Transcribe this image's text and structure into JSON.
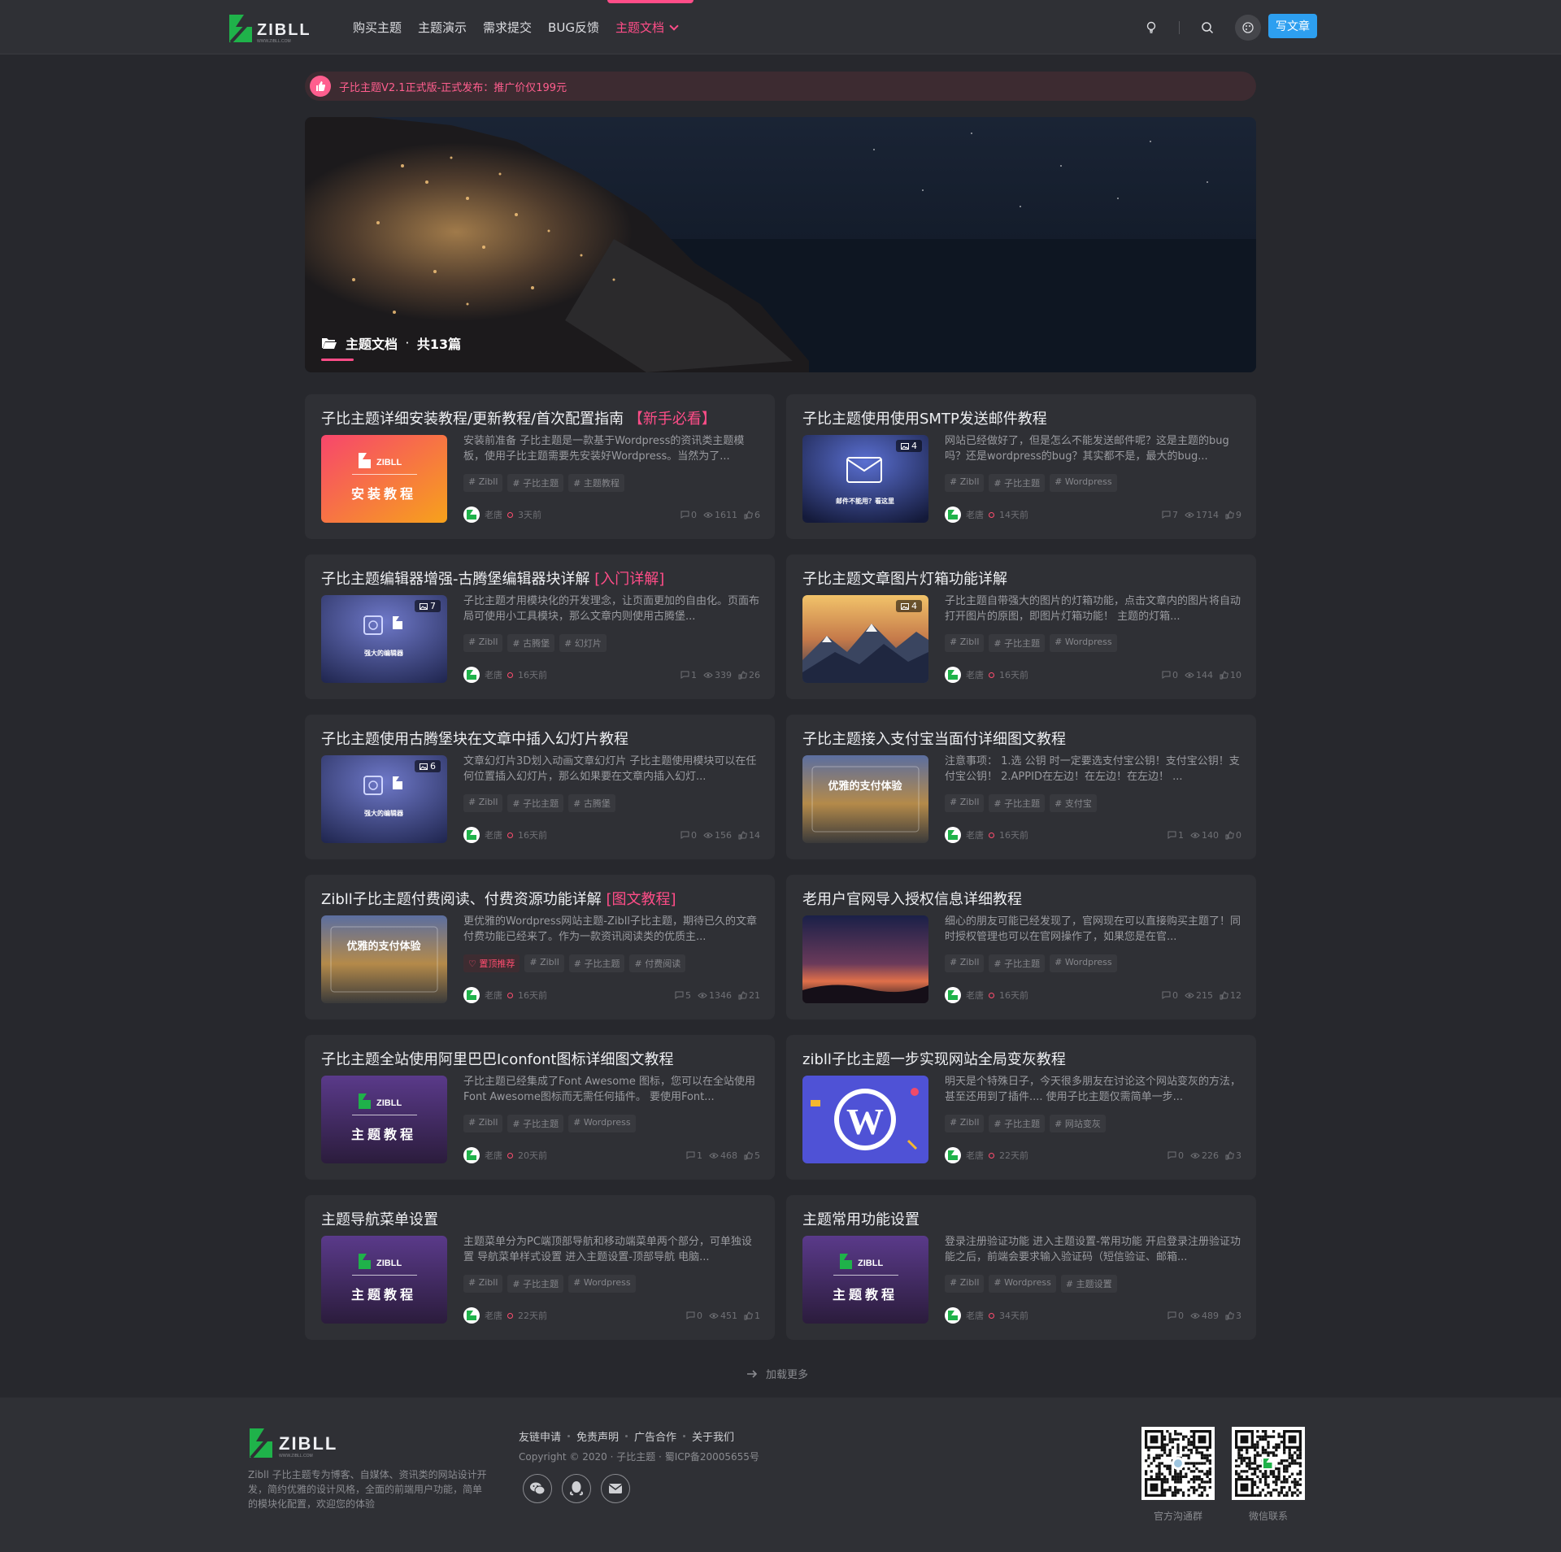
{
  "header": {
    "logo_text": "ZIBLL",
    "logo_sub": "WWW.ZIBLL.COM",
    "nav": [
      {
        "label": "购买主题"
      },
      {
        "label": "主题演示"
      },
      {
        "label": "需求提交"
      },
      {
        "label": "BUG反馈"
      },
      {
        "label": "主题文档"
      }
    ],
    "write_label": "写文章"
  },
  "notice": {
    "text": "子比主题V2.1正式版-正式发布：推广价仅199元"
  },
  "banner": {
    "category": "主题文档",
    "count": "共13篇"
  },
  "cards": [
    {
      "title": "子比主题详细安装教程/更新教程/首次配置指南",
      "title_tag": "【新手必看】",
      "thumb": "install",
      "thumb_text": "安装教程",
      "img_count": "",
      "excerpt": "安装前准备 子比主题是一款基于Wordpress的资讯类主题模板，使用子比主题需要先安装好Wordpress。当然为了...",
      "top_tag": "",
      "tags": [
        "# Zibll",
        "# 子比主题",
        "# 主题教程"
      ],
      "author": "老唐",
      "time": "3天前",
      "comments": "0",
      "views": "1611",
      "likes": "6"
    },
    {
      "title": "子比主题使用使用SMTP发送邮件教程",
      "title_tag": "",
      "thumb": "smtp",
      "thumb_text": "邮件不能用？看这里",
      "img_count": "4",
      "excerpt": "网站已经做好了，但是怎么不能发送邮件呢？这是主题的bug吗？还是wordpress的bug？其实都不是，最大的bug...",
      "top_tag": "",
      "tags": [
        "# Zibll",
        "# 子比主题",
        "# Wordpress"
      ],
      "author": "老唐",
      "time": "14天前",
      "comments": "7",
      "views": "1714",
      "likes": "9"
    },
    {
      "title": "子比主题编辑器增强-古腾堡编辑器块详解",
      "title_tag": "[入门详解]",
      "thumb": "gutenberg",
      "thumb_text": "强大的编辑器",
      "img_count": "7",
      "excerpt": "子比主题才用模块化的开发理念，让页面更加的自由化。页面布局可使用小工具模块，那么文章内则使用古腾堡...",
      "top_tag": "",
      "tags": [
        "# Zibll",
        "# 古腾堡",
        "# 幻灯片"
      ],
      "author": "老唐",
      "time": "16天前",
      "comments": "1",
      "views": "339",
      "likes": "26"
    },
    {
      "title": "子比主题文章图片灯箱功能详解",
      "title_tag": "",
      "thumb": "mountain",
      "thumb_text": "",
      "img_count": "4",
      "excerpt": "子比主题自带强大的图片的灯箱功能，点击文章内的图片将自动打开图片的原图，即图片灯箱功能！ 主题的灯箱...",
      "top_tag": "",
      "tags": [
        "# Zibll",
        "# 子比主题",
        "# Wordpress"
      ],
      "author": "老唐",
      "time": "16天前",
      "comments": "0",
      "views": "144",
      "likes": "10"
    },
    {
      "title": "子比主题使用古腾堡块在文章中插入幻灯片教程",
      "title_tag": "",
      "thumb": "gutenberg",
      "thumb_text": "强大的编辑器",
      "img_count": "6",
      "excerpt": "文章幻灯片3D划入动画文章幻灯片 子比主题使用模块可以在任何位置插入幻灯片，那么如果要在文章内插入幻灯...",
      "top_tag": "",
      "tags": [
        "# Zibll",
        "# 子比主题",
        "# 古腾堡"
      ],
      "author": "老唐",
      "time": "16天前",
      "comments": "0",
      "views": "156",
      "likes": "14"
    },
    {
      "title": "子比主题接入支付宝当面付详细图文教程",
      "title_tag": "",
      "thumb": "pay",
      "thumb_text": "优雅的支付体验",
      "img_count": "",
      "excerpt": "注意事项： 1.选 公钥 时一定要选支付宝公钥！支付宝公钥！支付宝公钥！ 2.APPID在左边！在左边！在左边！ ...",
      "top_tag": "",
      "tags": [
        "# Zibll",
        "# 子比主题",
        "# 支付宝"
      ],
      "author": "老唐",
      "time": "16天前",
      "comments": "1",
      "views": "140",
      "likes": "0"
    },
    {
      "title": "Zibll子比主题付费阅读、付费资源功能详解",
      "title_tag": "[图文教程]",
      "thumb": "pay",
      "thumb_text": "优雅的支付体验",
      "img_count": "",
      "excerpt": "更优雅的Wordpress网站主题-Zibll子比主题，期待已久的文章付费功能已经来了。作为一款资讯阅读类的优质主...",
      "top_tag": "置顶推荐",
      "tags": [
        "# Zibll",
        "# 子比主题",
        "# 付费阅读"
      ],
      "author": "老唐",
      "time": "16天前",
      "comments": "5",
      "views": "1346",
      "likes": "21"
    },
    {
      "title": "老用户官网导入授权信息详细教程",
      "title_tag": "",
      "thumb": "sunset",
      "thumb_text": "",
      "img_count": "",
      "excerpt": "细心的朋友可能已经发现了，官网现在可以直接购买主题了！同时授权管理也可以在官网操作了，如果您是在官...",
      "top_tag": "",
      "tags": [
        "# Zibll",
        "# 子比主题",
        "# Wordpress"
      ],
      "author": "老唐",
      "time": "16天前",
      "comments": "0",
      "views": "215",
      "likes": "12"
    },
    {
      "title": "子比主题全站使用阿里巴巴Iconfont图标详细图文教程",
      "title_tag": "",
      "thumb": "theme",
      "thumb_text": "主题教程",
      "img_count": "",
      "excerpt": "子比主题已经集成了Font Awesome 图标，您可以在全站使用Font Awesome图标而无需任何插件。 要使用Font...",
      "top_tag": "",
      "tags": [
        "# Zibll",
        "# 子比主题",
        "# Wordpress"
      ],
      "author": "老唐",
      "time": "20天前",
      "comments": "1",
      "views": "468",
      "likes": "5"
    },
    {
      "title": "zibll子比主题一步实现网站全局变灰教程",
      "title_tag": "",
      "thumb": "wp",
      "thumb_text": "",
      "img_count": "",
      "excerpt": "明天是个特殊日子，今天很多朋友在讨论这个网站变灰的方法，甚至还用到了插件.... 使用子比主题仅需简单一步...",
      "top_tag": "",
      "tags": [
        "# Zibll",
        "# 子比主题",
        "# 网站变灰"
      ],
      "author": "老唐",
      "time": "22天前",
      "comments": "0",
      "views": "226",
      "likes": "3"
    },
    {
      "title": "主题导航菜单设置",
      "title_tag": "",
      "thumb": "theme",
      "thumb_text": "主题教程",
      "img_count": "",
      "excerpt": "主题菜单分为PC端顶部导航和移动端菜单两个部分，可单独设置 导航菜单样式设置 进入主题设置-顶部导航 电脑...",
      "top_tag": "",
      "tags": [
        "# Zibll",
        "# 子比主题",
        "# Wordpress"
      ],
      "author": "老唐",
      "time": "22天前",
      "comments": "0",
      "views": "451",
      "likes": "1"
    },
    {
      "title": "主题常用功能设置",
      "title_tag": "",
      "thumb": "theme",
      "thumb_text": "主题教程",
      "img_count": "",
      "excerpt": "登录注册验证功能 进入主题设置-常用功能 开启登录注册验证功能之后，前端会要求输入验证码（短信验证、邮箱...",
      "top_tag": "",
      "tags": [
        "# Zibll",
        "# Wordpress",
        "# 主题设置"
      ],
      "author": "老唐",
      "time": "34天前",
      "comments": "0",
      "views": "489",
      "likes": "3"
    }
  ],
  "load_more": "加载更多",
  "footer": {
    "desc": "Zibll 子比主题专为博客、自媒体、资讯类的网站设计开发，简约优雅的设计风格，全面的前端用户功能，简单的模块化配置，欢迎您的体验",
    "links": [
      "友链申请",
      "免责声明",
      "广告合作",
      "关于我们"
    ],
    "copyright": "Copyright © 2020 · 子比主题 · 蜀ICP备20005655号",
    "qr_labels": [
      "官方沟通群",
      "微信联系"
    ]
  },
  "colors": {
    "accent": "#ff4d88",
    "primary": "#2d9ff0",
    "logo_green": "#1fb24a"
  }
}
